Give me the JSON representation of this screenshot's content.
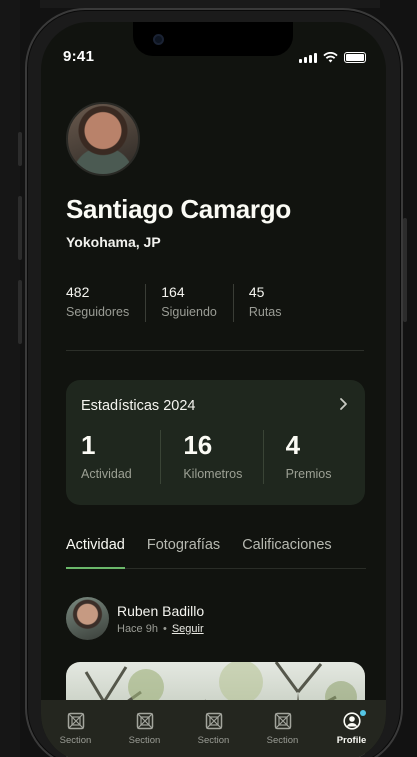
{
  "status_bar": {
    "time": "9:41"
  },
  "profile": {
    "name": "Santiago Camargo",
    "location": "Yokohama, JP",
    "stats": [
      {
        "value": "482",
        "label": "Seguidores"
      },
      {
        "value": "164",
        "label": "Siguiendo"
      },
      {
        "value": "45",
        "label": "Rutas"
      }
    ]
  },
  "stats_card": {
    "title": "Estadísticas 2024",
    "metrics": [
      {
        "value": "1",
        "label": "Actividad"
      },
      {
        "value": "16",
        "label": "Kilometros"
      },
      {
        "value": "4",
        "label": "Premios"
      }
    ]
  },
  "tabs": [
    {
      "label": "Actividad",
      "active": true
    },
    {
      "label": "Fotografías",
      "active": false
    },
    {
      "label": "Calificaciones",
      "active": false
    }
  ],
  "post": {
    "author": "Ruben Badillo",
    "time": "Hace 9h",
    "separator": "•",
    "follow_label": "Seguir"
  },
  "tab_bar": [
    {
      "label": "Section",
      "icon": "section-icon"
    },
    {
      "label": "Section",
      "icon": "section-icon"
    },
    {
      "label": "Section",
      "icon": "section-icon"
    },
    {
      "label": "Section",
      "icon": "section-icon"
    },
    {
      "label": "Profile",
      "icon": "profile-icon",
      "active": true
    }
  ],
  "colors": {
    "background": "#11130f",
    "card": "#1f271e",
    "accent": "#6bb86a",
    "tab_bar": "#24261f",
    "notification_dot": "#55c6e6"
  }
}
